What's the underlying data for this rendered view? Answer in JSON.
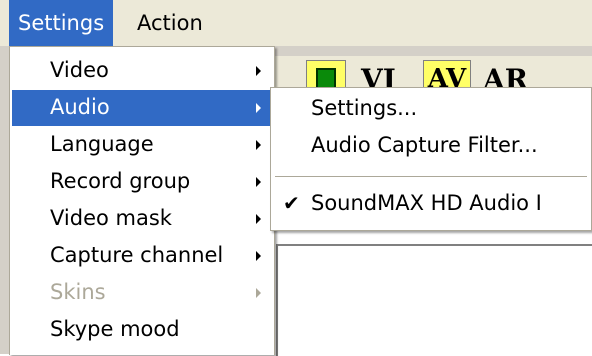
{
  "menubar": {
    "items": [
      {
        "label": "Settings"
      },
      {
        "label": "Action"
      }
    ]
  },
  "toolbar": {
    "buttons": [
      "VI",
      "AV",
      "AR"
    ]
  },
  "settings_menu": {
    "items": [
      {
        "label": "Video",
        "has_submenu": true
      },
      {
        "label": "Audio",
        "has_submenu": true,
        "highlighted": true
      },
      {
        "label": "Language",
        "has_submenu": true
      },
      {
        "label": "Record group",
        "has_submenu": true
      },
      {
        "label": "Video mask",
        "has_submenu": true
      },
      {
        "label": "Capture channel",
        "has_submenu": true
      },
      {
        "label": "Skins",
        "has_submenu": true,
        "disabled": true
      },
      {
        "label": "Skype mood",
        "has_submenu": false
      }
    ]
  },
  "audio_submenu": {
    "items": [
      {
        "label": "Settings..."
      },
      {
        "label": "Audio Capture Filter..."
      },
      {
        "label": "SoundMAX HD Audio I",
        "checked": true,
        "check_glyph": "✔"
      }
    ]
  },
  "colors": {
    "highlight": "#316ac5",
    "menubar": "#ece9d8",
    "disabled_text": "#aca899",
    "toolbar_button": "#ffff66"
  }
}
